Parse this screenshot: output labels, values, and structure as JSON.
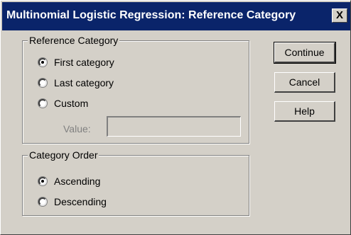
{
  "window": {
    "title": "Multinomial Logistic Regression: Reference Category",
    "close_label": "X"
  },
  "reference_category": {
    "label": "Reference Category",
    "options": [
      {
        "label": "First category",
        "selected": true
      },
      {
        "label": "Last category",
        "selected": false
      },
      {
        "label": "Custom",
        "selected": false
      }
    ],
    "value_label": "Value:",
    "value": ""
  },
  "category_order": {
    "label": "Category Order",
    "options": [
      {
        "label": "Ascending",
        "selected": true
      },
      {
        "label": "Descending",
        "selected": false
      }
    ]
  },
  "buttons": {
    "continue": "Continue",
    "cancel": "Cancel",
    "help": "Help"
  }
}
